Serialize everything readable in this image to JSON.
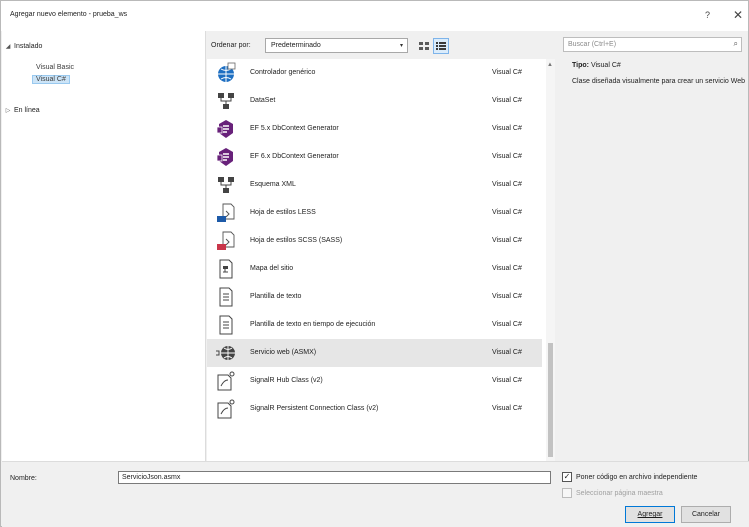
{
  "window": {
    "title": "Agregar nuevo elemento - prueba_ws",
    "help_label": "?",
    "close_label": "✕"
  },
  "tree": {
    "installed": "Instalado",
    "installed_arrow": "◢",
    "children": [
      "Visual Basic",
      "Visual C#"
    ],
    "online": "En línea",
    "online_arrow": "▷"
  },
  "toolbar": {
    "sort_label": "Ordenar por:",
    "sort_value": "Predeterminado",
    "dropdown_glyph": "▾"
  },
  "items": [
    {
      "name": "Controlador genérico",
      "lang": "Visual C#",
      "icon": "globe-page-icon"
    },
    {
      "name": "DataSet",
      "lang": "Visual C#",
      "icon": "dataset-icon"
    },
    {
      "name": "EF 5.x DbContext Generator",
      "lang": "Visual C#",
      "icon": "ef-generator-icon"
    },
    {
      "name": "EF 6.x DbContext Generator",
      "lang": "Visual C#",
      "icon": "ef-generator-icon"
    },
    {
      "name": "Esquema XML",
      "lang": "Visual C#",
      "icon": "xml-schema-icon"
    },
    {
      "name": "Hoja de estilos LESS",
      "lang": "Visual C#",
      "icon": "less-stylesheet-icon"
    },
    {
      "name": "Hoja de estilos SCSS (SASS)",
      "lang": "Visual C#",
      "icon": "scss-stylesheet-icon"
    },
    {
      "name": "Mapa del sitio",
      "lang": "Visual C#",
      "icon": "sitemap-icon"
    },
    {
      "name": "Plantilla de texto",
      "lang": "Visual C#",
      "icon": "text-template-icon"
    },
    {
      "name": "Plantilla de texto en tiempo de ejecución",
      "lang": "Visual C#",
      "icon": "text-template-icon"
    },
    {
      "name": "Servicio web (ASMX)",
      "lang": "Visual C#",
      "icon": "web-service-icon"
    },
    {
      "name": "SignalR Hub Class (v2)",
      "lang": "Visual C#",
      "icon": "signalr-icon"
    },
    {
      "name": "SignalR Persistent Connection Class (v2)",
      "lang": "Visual C#",
      "icon": "signalr-icon"
    }
  ],
  "selected_item_index": 10,
  "search": {
    "placeholder": "Buscar (Ctrl+E)",
    "icon_glyph": "⌕"
  },
  "details": {
    "type_label": "Tipo:",
    "type_value": "Visual C#",
    "description": "Clase diseñada visualmente para crear un servicio Web"
  },
  "bottom": {
    "name_label": "Nombre:",
    "name_value": "ServicioJson.asmx",
    "checkbox1_label": "Poner código en archivo independiente",
    "checkbox1_checked": true,
    "checkbox1_mark": "✓",
    "checkbox2_label": "Seleccionar página maestra",
    "checkbox2_checked": false,
    "add_button": "Agregar",
    "cancel_button": "Cancelar"
  },
  "colors": {
    "selection": "#cce4f7",
    "accent": "#0078d7",
    "ef_purple": "#68217a",
    "globe_blue": "#1e6fc2",
    "less_blue": "#1d5aa8",
    "scss_red": "#c9364a"
  }
}
